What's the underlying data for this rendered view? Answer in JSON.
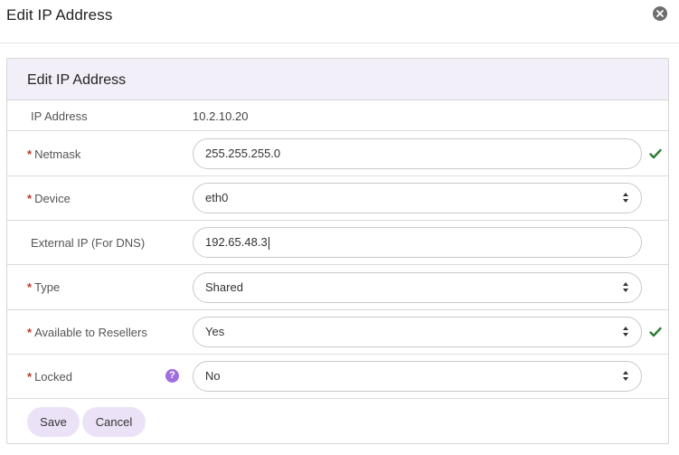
{
  "modal": {
    "title": "Edit IP Address"
  },
  "panel": {
    "title": "Edit IP Address"
  },
  "form": {
    "ip_address": {
      "label": "IP Address",
      "value": "10.2.10.20"
    },
    "netmask": {
      "label": "Netmask",
      "required_mark": "*",
      "value": "255.255.255.0",
      "valid": true
    },
    "device": {
      "label": "Device",
      "required_mark": "*",
      "value": "eth0"
    },
    "external_ip": {
      "label": "External IP (For DNS)",
      "value": "192.65.48.3"
    },
    "type": {
      "label": "Type",
      "required_mark": "*",
      "value": "Shared"
    },
    "resellers": {
      "label": "Available to Resellers",
      "required_mark": "*",
      "value": "Yes",
      "valid": true
    },
    "locked": {
      "label": "Locked",
      "required_mark": "*",
      "value": "No",
      "help_glyph": "?"
    }
  },
  "actions": {
    "save_label": "Save",
    "cancel_label": "Cancel"
  },
  "colors": {
    "panel_header_bg": "#f3eff8",
    "button_bg": "#ece2f7",
    "help_icon": "#a26ddf",
    "valid_check": "#2e7d32",
    "required_mark": "#c0392b"
  },
  "icons": {
    "close": "close-icon",
    "check": "checkmark-icon",
    "help": "help-icon",
    "select": "select-caret-icon"
  }
}
